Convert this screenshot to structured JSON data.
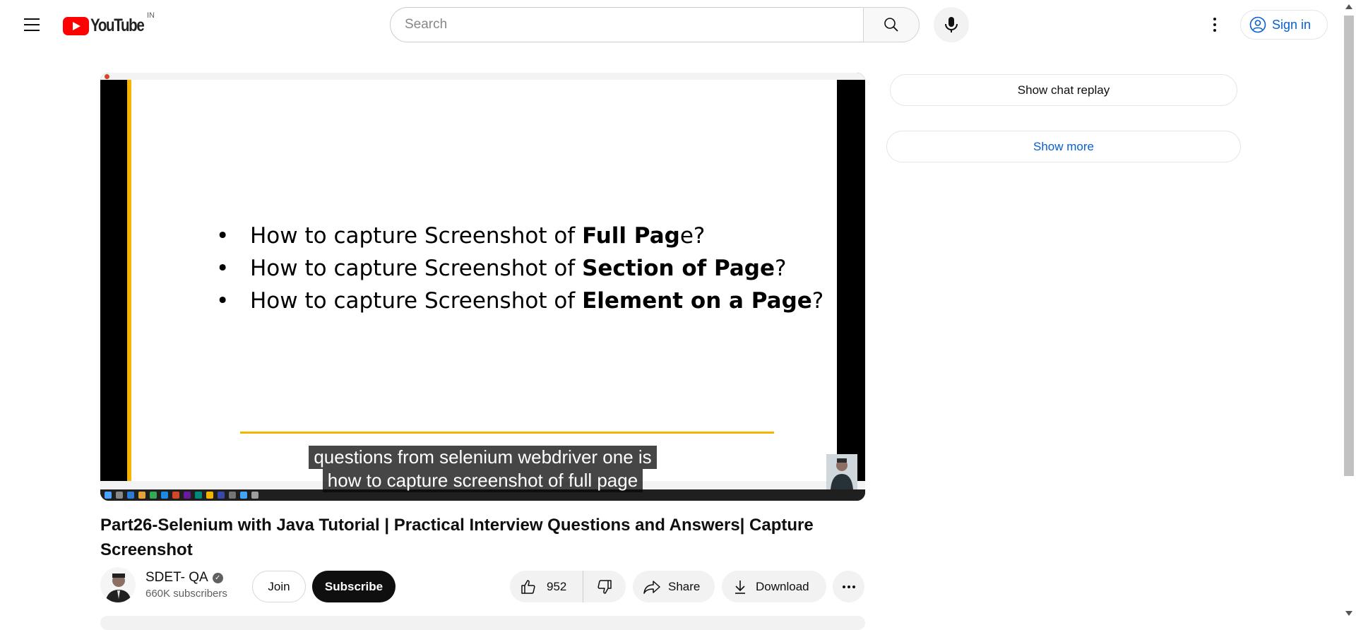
{
  "header": {
    "logo_text": "YouTube",
    "country_code": "IN",
    "search_placeholder": "Search",
    "sign_in_label": "Sign in"
  },
  "player": {
    "slide_bullets": [
      {
        "plain": "How to capture Screenshot of ",
        "bold": "Full Pag",
        "tail": "e?"
      },
      {
        "plain": "How to capture Screenshot of ",
        "bold": "Section of  Page",
        "tail": "?"
      },
      {
        "plain": "How to capture Screenshot of ",
        "bold": "Element on a  Page",
        "tail": "?"
      }
    ],
    "caption_line1": "questions from selenium webdriver one is",
    "caption_line2": "how to capture screenshot of full page"
  },
  "video": {
    "title": "Part26-Selenium with Java Tutorial | Practical Interview Questions and Answers| Capture Screenshot",
    "channel_name": "SDET- QA",
    "subscribers": "660K subscribers",
    "join_label": "Join",
    "subscribe_label": "Subscribe",
    "like_count": "952",
    "share_label": "Share",
    "download_label": "Download"
  },
  "sidebar": {
    "chat_replay_label": "Show chat replay",
    "show_more_label": "Show more"
  },
  "colors": {
    "brand_red": "#ff0000",
    "link_blue": "#065fd4",
    "slide_accent": "#f4b400"
  }
}
